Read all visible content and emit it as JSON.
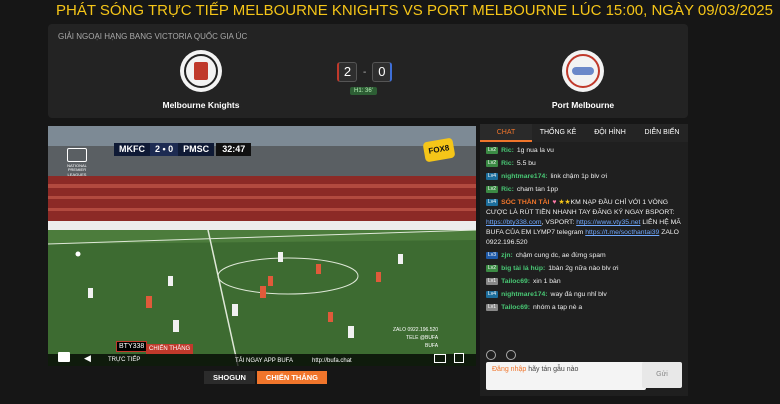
{
  "page_title": "PHÁT SÓNG TRỰC TIẾP MELBOURNE KNIGHTS VS PORT MELBOURNE LÚC 15:00, NGÀY 09/03/2025",
  "match": {
    "league": "GIẢI NGOẠI HẠNG BANG VICTORIA QUỐC GIA ÚC",
    "home": {
      "name": "Melbourne Knights",
      "crest_icon": "melbourne-knights-crest-icon"
    },
    "away": {
      "name": "Port Melbourne",
      "crest_icon": "port-melbourne-sharks-crest-icon"
    },
    "score_home": "2",
    "score_away": "0",
    "separator": "-",
    "status": "H1: 36'"
  },
  "video": {
    "scorebug": {
      "home_abbr": "MKFC",
      "score": "2 • 0",
      "away_abbr": "PMSC",
      "clock": "32:47"
    },
    "league_logo_text": "NATIONAL PREMIER LEAGUES",
    "broadcaster_logo": "FOX8",
    "overlay": {
      "badge1": "BTY338",
      "badge2": "CHIẾN THẮNG",
      "live_label": "TRỰC TIẾP",
      "promo": "TẢI NGAY APP BUFA",
      "url": "http://bufa.chat",
      "zalo": "ZALO 0922.196.520",
      "tele": "TELE @BUFA",
      "bufa": "BUFA"
    }
  },
  "bottom_tabs": [
    {
      "label": "SHOGUN",
      "active": false
    },
    {
      "label": "CHIẾN THẮNG",
      "active": true
    }
  ],
  "chat": {
    "tabs": [
      {
        "label": "CHAT",
        "active": true
      },
      {
        "label": "THỐNG KÊ",
        "active": false
      },
      {
        "label": "ĐỘI HÌNH",
        "active": false
      },
      {
        "label": "DIỄN BIẾN",
        "active": false
      }
    ],
    "messages": [
      {
        "level": "Lv2",
        "user": "Ric:",
        "text": "1g nua la vu"
      },
      {
        "level": "Lv2",
        "user": "Ric:",
        "text": "5.5 bu"
      },
      {
        "level": "Lv4",
        "user": "nightmare174:",
        "text": "link chậm 1p blv ơi"
      },
      {
        "level": "Lv2",
        "user": "Ric:",
        "text": "cham tan 1pp"
      },
      {
        "level": "Lv4",
        "user": "SÓC THẦN TÀI",
        "text": "KM NẠP ĐẦU CHỈ VỚI 1 VÒNG CƯỢC LÀ RÚT TIỀN NHANH TAY ĐĂNG KÝ NGAY BSPORT:",
        "link1": "https://bty338.com",
        "mid": ", VSPORT:",
        "link2": "https://www.vty35.net",
        "tail": "LIÊN HỆ MÃ BUFA CỦA EM LYMP7 telegram",
        "link3": "https://t.me/socthantai39",
        "end": "ZALO 0922.196.520"
      },
      {
        "level": "Lv3",
        "user": "zjn:",
        "text": "chậm cung dc, ae đừng spam"
      },
      {
        "level": "Lv2",
        "user": "big tài lá húp:",
        "text": "1bàn 2g nữa nào blv ơi"
      },
      {
        "level": "Lv1",
        "user": "Tailoc69:",
        "text": "xin 1 bàn"
      },
      {
        "level": "Lv4",
        "user": "nightmare174:",
        "text": "way đá ngu nhỉ blv"
      },
      {
        "level": "Lv1",
        "user": "Tailoc69:",
        "text": "nhóm a tạp nè a"
      }
    ],
    "input_login": "Đăng nhập",
    "input_placeholder": "hãy tán gẫu nào",
    "send_label": "Gửi"
  }
}
